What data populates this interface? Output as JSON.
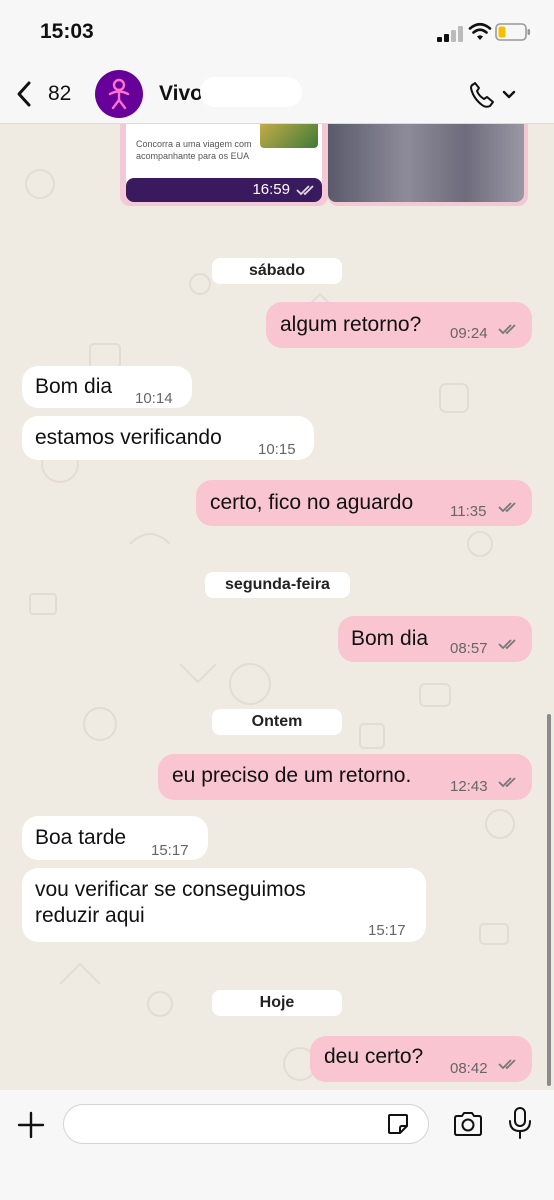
{
  "status_bar": {
    "time": "15:03"
  },
  "header": {
    "back_count": "82",
    "contact_name": "Vivo",
    "avatar_icon": "vivo-logo-icon",
    "brand_color": "#660099"
  },
  "media_preview": {
    "card_text": "Concorra a uma viagem com acompanhante para os EUA",
    "time": "16:59"
  },
  "messages": [
    {
      "type": "date",
      "label": "sábado"
    },
    {
      "type": "out",
      "text": "algum retorno?",
      "time": "09:24"
    },
    {
      "type": "in",
      "text": "Bom dia",
      "time": "10:14"
    },
    {
      "type": "in",
      "text": "estamos verificando",
      "time": "10:15"
    },
    {
      "type": "out",
      "text": "certo, fico no aguardo",
      "time": "11:35"
    },
    {
      "type": "date",
      "label": "segunda-feira"
    },
    {
      "type": "out",
      "text": "Bom dia",
      "time": "08:57"
    },
    {
      "type": "date",
      "label": "Ontem"
    },
    {
      "type": "out",
      "text": "eu preciso de um retorno.",
      "time": "12:43"
    },
    {
      "type": "in",
      "text": "Boa tarde",
      "time": "15:17"
    },
    {
      "type": "in",
      "text": "vou verificar se conseguimos reduzir aqui",
      "time": "15:17"
    },
    {
      "type": "date",
      "label": "Hoje"
    },
    {
      "type": "out",
      "text": "deu certo?",
      "time": "08:42"
    }
  ],
  "composer": {
    "placeholder": ""
  },
  "colors": {
    "outgoing_bubble": "#f9c5d1",
    "incoming_bubble": "#ffffff",
    "chat_background": "#efeae2"
  }
}
